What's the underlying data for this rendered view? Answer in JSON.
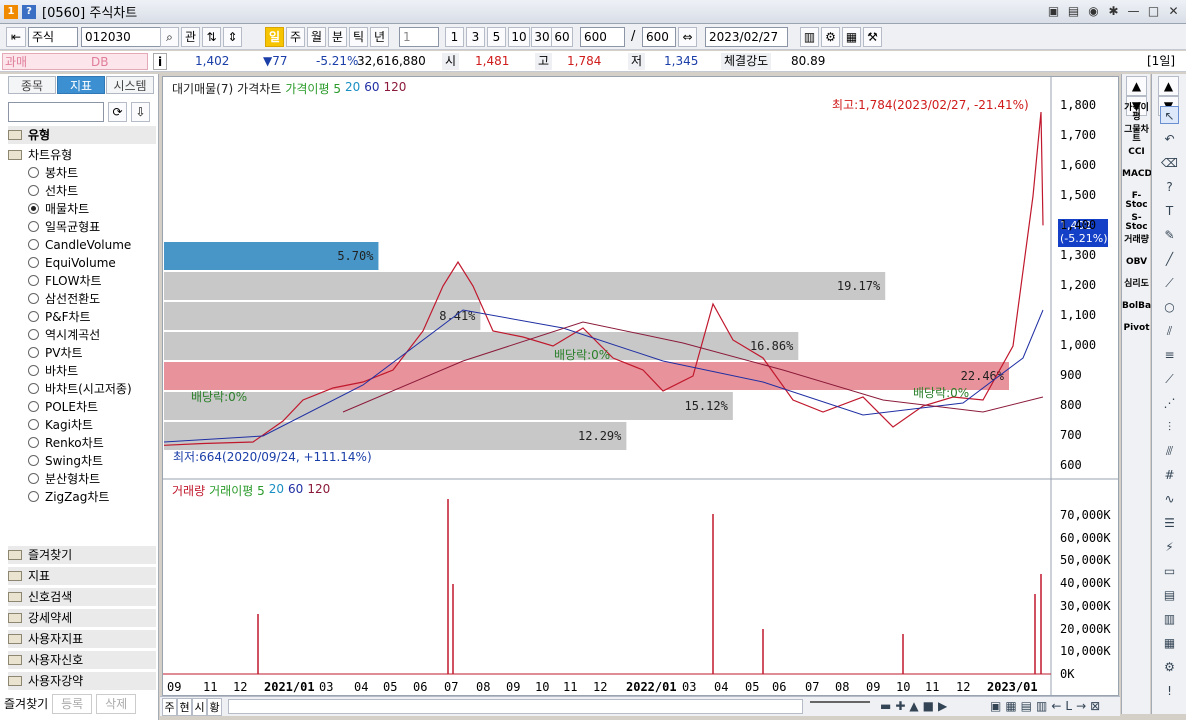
{
  "window": {
    "title_prefix": "1",
    "title": "[0560] 주식차트"
  },
  "toolbar": {
    "market": "주식",
    "code": "012030",
    "search_icon": "magnifier-icon",
    "kwan": "관",
    "periods": [
      "일",
      "주",
      "월",
      "분",
      "틱",
      "년"
    ],
    "selected_period": "일",
    "unit": "1",
    "intervals": [
      "1",
      "3",
      "5",
      "10",
      "30",
      "60"
    ],
    "count": "600",
    "count_total": "600",
    "date": "2023/02/27"
  },
  "quote": {
    "name": "DB",
    "info": "i",
    "price": "1,402",
    "change": "▼77",
    "change_pct": "-5.21%",
    "volume": "32,616,880",
    "open_label": "시",
    "open": "1,481",
    "high_label": "고",
    "high": "1,784",
    "low_label": "저",
    "low": "1,345",
    "strength_label": "체결강도",
    "strength": "80.89",
    "day_label": "[1일]",
    "badge": "과매"
  },
  "sidebar": {
    "tabs": [
      "종목",
      "지표",
      "시스템"
    ],
    "active_tab": "지표",
    "group": "유형",
    "subgroup": "차트유형",
    "chart_types": [
      "봉차트",
      "선차트",
      "매물차트",
      "일목균형표",
      "CandleVolume",
      "EquiVolume",
      "FLOW차트",
      "삼선전환도",
      "P&F차트",
      "역시계곡선",
      "PV차트",
      "바차트",
      "바차트(시고저종)",
      "POLE차트",
      "Kagi차트",
      "Renko차트",
      "Swing차트",
      "분산형차트",
      "ZigZag차트"
    ],
    "selected_type": "매물차트",
    "bottom_groups": [
      "즐겨찾기",
      "지표",
      "신호검색",
      "강세약세",
      "사용자지표",
      "사용자신호",
      "사용자강약"
    ],
    "footer": [
      "즐겨찾기",
      "등록",
      "삭제"
    ]
  },
  "chart": {
    "price_legend": [
      "대기매물(7)",
      "가격차트",
      "가격이평 5",
      "20",
      "60",
      "120"
    ],
    "volume_legend": [
      "거래량",
      "거래이평 5",
      "20",
      "60",
      "120"
    ],
    "high_note": "최고:1,784(2023/02/27, -21.41%)",
    "low_note": "최저:664(2020/09/24, +111.14%)",
    "current_price": "1,402",
    "current_pct": "(-5.21%)",
    "div_notes": [
      "배당락:0%",
      "배당락:0%",
      "배당락:0%"
    ],
    "price_axis": [
      "1,800",
      "1,700",
      "1,600",
      "1,500",
      "1,400",
      "1,300",
      "1,200",
      "1,100",
      "1,000",
      "900",
      "800",
      "700",
      "600"
    ],
    "volume_axis": [
      "70,000K",
      "60,000K",
      "50,000K",
      "40,000K",
      "30,000K",
      "20,000K",
      "10,000K",
      "0K"
    ],
    "x_axis": [
      "09",
      "11",
      "12",
      "2021/01",
      "03",
      "04",
      "05",
      "06",
      "07",
      "08",
      "09",
      "10",
      "11",
      "12",
      "2022/01",
      "03",
      "04",
      "05",
      "06",
      "07",
      "08",
      "09",
      "10",
      "11",
      "12",
      "2023/01"
    ],
    "bottom_tabs": [
      "주",
      "현",
      "시",
      "황"
    ]
  },
  "chart_data": {
    "type": "bar",
    "title": "",
    "volume_profile": [
      {
        "price_from": 1250,
        "price_to": 1350,
        "pct": 5.7
      },
      {
        "price_from": 1150,
        "price_to": 1250,
        "pct": 19.17
      },
      {
        "price_from": 1050,
        "price_to": 1150,
        "pct": 8.41
      },
      {
        "price_from": 950,
        "price_to": 1050,
        "pct": 16.86
      },
      {
        "price_from": 850,
        "price_to": 950,
        "pct": 22.46
      },
      {
        "price_from": 750,
        "price_to": 850,
        "pct": 15.12
      },
      {
        "price_from": 650,
        "price_to": 750,
        "pct": 12.29
      }
    ],
    "ylim": [
      600,
      1800
    ],
    "colors": {
      "highlight": "#e8939b",
      "top": "#4796c7",
      "bar": "#c8c8c8"
    }
  },
  "right_panel": {
    "indicators": [
      "가격이평",
      "그물차트",
      "CCI",
      "MACD",
      "F-Stoc",
      "S-Stoc",
      "거래량",
      "OBV",
      "심리도",
      "BolBand",
      "Pivot"
    ]
  }
}
